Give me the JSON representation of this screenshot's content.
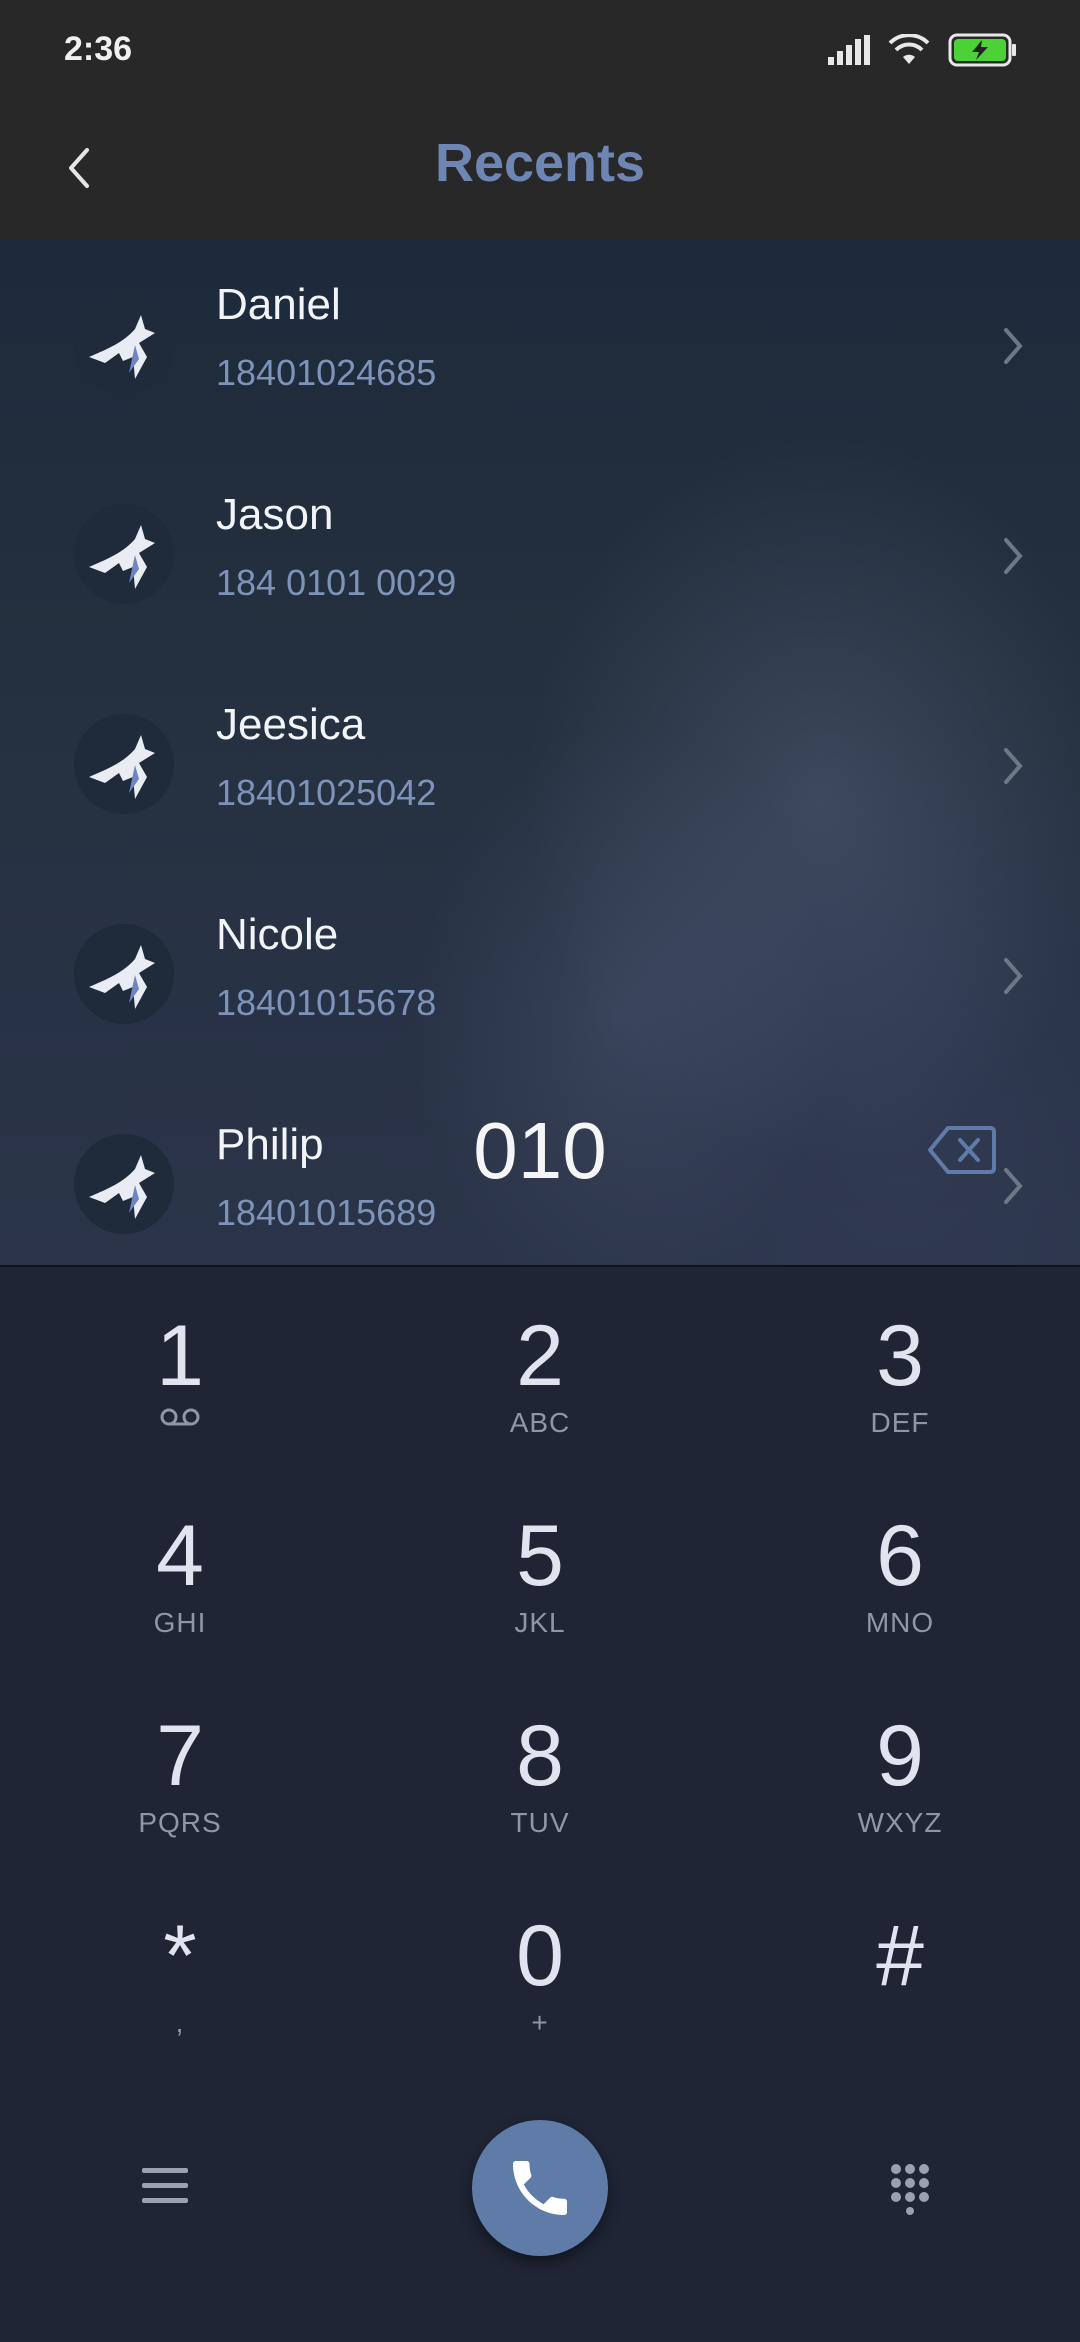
{
  "status_bar": {
    "time": "2:36"
  },
  "header": {
    "title": "Recents"
  },
  "recents": [
    {
      "name": "Daniel",
      "number": "18401024685"
    },
    {
      "name": "Jason",
      "number": "184 0101 0029"
    },
    {
      "name": "Jeesica",
      "number": "18401025042"
    },
    {
      "name": "Nicole",
      "number": "18401015678"
    },
    {
      "name": "Philip",
      "number": "18401015689"
    }
  ],
  "dialer": {
    "input": "010",
    "keys": [
      {
        "digit": "1",
        "letters": ""
      },
      {
        "digit": "2",
        "letters": "ABC"
      },
      {
        "digit": "3",
        "letters": "DEF"
      },
      {
        "digit": "4",
        "letters": "GHI"
      },
      {
        "digit": "5",
        "letters": "JKL"
      },
      {
        "digit": "6",
        "letters": "MNO"
      },
      {
        "digit": "7",
        "letters": "PQRS"
      },
      {
        "digit": "8",
        "letters": "TUV"
      },
      {
        "digit": "9",
        "letters": "WXYZ"
      },
      {
        "digit": "*",
        "letters": ","
      },
      {
        "digit": "0",
        "letters": "+"
      },
      {
        "digit": "#",
        "letters": ""
      }
    ]
  },
  "icons": {
    "back": "chevron-left-icon",
    "backspace": "backspace-icon",
    "call": "phone-icon",
    "menu": "menu-icon",
    "keypad": "dialpad-grid-icon",
    "voicemail": "voicemail-icon"
  },
  "colors": {
    "accent": "#5f7ba8",
    "title": "#6e86b4",
    "number": "#7e93b9",
    "battery": "#4cd137"
  }
}
